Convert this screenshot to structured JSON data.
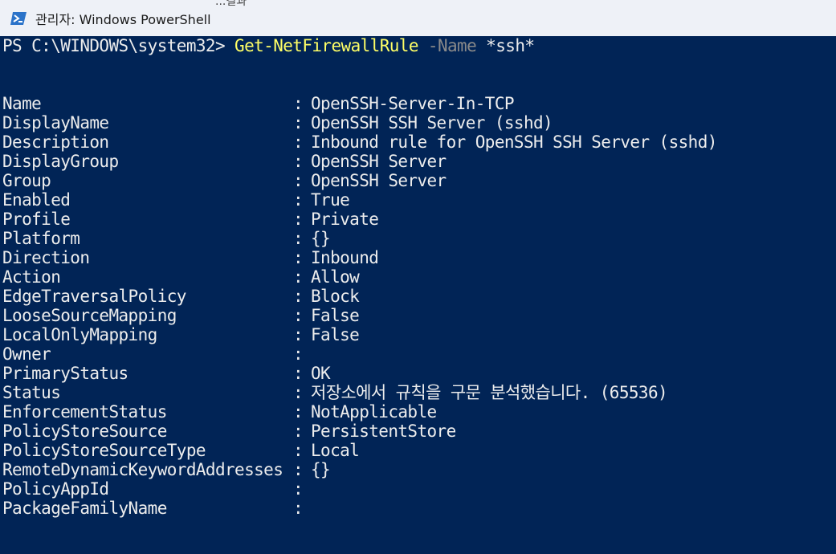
{
  "window": {
    "title": "관리자: Windows PowerShell",
    "top_fragment": "...결과",
    "icon": "powershell-icon"
  },
  "console": {
    "prompt": "PS C:\\WINDOWS\\system32> ",
    "command": "Get-NetFirewallRule",
    "param_name": " -Name",
    "param_value": " *ssh*",
    "separator": ":",
    "properties": [
      {
        "key": "Name",
        "value": "OpenSSH-Server-In-TCP"
      },
      {
        "key": "DisplayName",
        "value": "OpenSSH SSH Server (sshd)"
      },
      {
        "key": "Description",
        "value": "Inbound rule for OpenSSH SSH Server (sshd)"
      },
      {
        "key": "DisplayGroup",
        "value": "OpenSSH Server"
      },
      {
        "key": "Group",
        "value": "OpenSSH Server"
      },
      {
        "key": "Enabled",
        "value": "True"
      },
      {
        "key": "Profile",
        "value": "Private"
      },
      {
        "key": "Platform",
        "value": "{}"
      },
      {
        "key": "Direction",
        "value": "Inbound"
      },
      {
        "key": "Action",
        "value": "Allow"
      },
      {
        "key": "EdgeTraversalPolicy",
        "value": "Block"
      },
      {
        "key": "LooseSourceMapping",
        "value": "False"
      },
      {
        "key": "LocalOnlyMapping",
        "value": "False"
      },
      {
        "key": "Owner",
        "value": ""
      },
      {
        "key": "PrimaryStatus",
        "value": "OK"
      },
      {
        "key": "Status",
        "value": "저장소에서 규칙을 구문 분석했습니다. (65536)"
      },
      {
        "key": "EnforcementStatus",
        "value": "NotApplicable"
      },
      {
        "key": "PolicyStoreSource",
        "value": "PersistentStore"
      },
      {
        "key": "PolicyStoreSourceType",
        "value": "Local"
      },
      {
        "key": "RemoteDynamicKeywordAddresses",
        "value": "{}"
      },
      {
        "key": "PolicyAppId",
        "value": ""
      },
      {
        "key": "PackageFamilyName",
        "value": ""
      }
    ]
  },
  "colors": {
    "console_background": "#012456",
    "console_text": "#ededed",
    "command_text": "#ffff66",
    "parameter_text": "#8a8a8a",
    "titlebar_background": "#eef1f7"
  }
}
